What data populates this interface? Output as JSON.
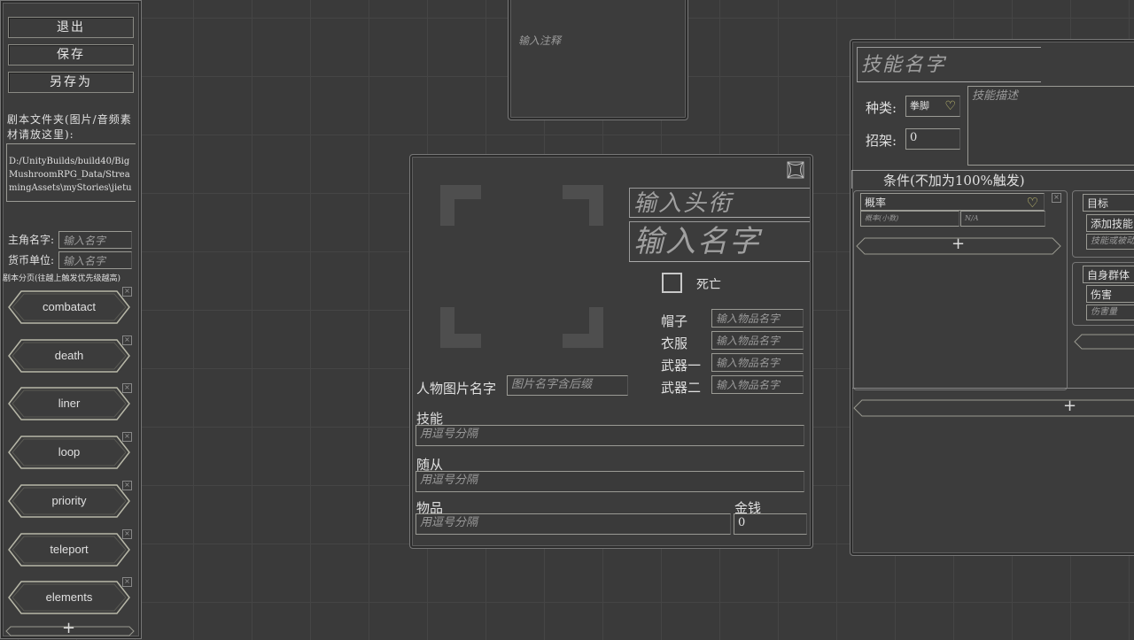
{
  "left": {
    "buttons": {
      "exit": "退出",
      "save": "保存",
      "save_as": "另存为"
    },
    "folder_label": "剧本文件夹(图片/音频素材请放这里):",
    "folder_path": "D:/UnityBuilds/build40/BigMushroomRPG_Data/StreamingAssets\\myStories\\jietu",
    "protagonist_label": "主角名字:",
    "protagonist_placeholder": "输入名字",
    "currency_label": "货币单位:",
    "currency_placeholder": "输入名字",
    "pages_label": "剧本分页(往越上触发优先级越高)",
    "pages": [
      "combatact",
      "death",
      "liner",
      "loop",
      "priority",
      "teleport",
      "elements"
    ],
    "add_glyph": "+"
  },
  "note": {
    "placeholder": "输入注释"
  },
  "character": {
    "title_placeholder": "输入头衔",
    "name_placeholder": "输入名字",
    "dead_label": "死亡",
    "equipment": [
      {
        "label": "帽子",
        "placeholder": "输入物品名字"
      },
      {
        "label": "衣服",
        "placeholder": "输入物品名字"
      },
      {
        "label": "武器一",
        "placeholder": "输入物品名字"
      },
      {
        "label": "武器二",
        "placeholder": "输入物品名字"
      }
    ],
    "image_label": "人物图片名字",
    "image_placeholder": "图片名字含后缀",
    "skills_label": "技能",
    "skills_placeholder": "用逗号分隔",
    "followers_label": "随从",
    "followers_placeholder": "用逗号分隔",
    "items_label": "物品",
    "items_placeholder": "用逗号分隔",
    "money_label": "金钱",
    "money_value": "0"
  },
  "skill": {
    "name_placeholder": "技能名字",
    "type_label": "种类:",
    "type_value": "拳脚",
    "desc_placeholder": "技能描述",
    "parry_label": "招架:",
    "parry_value": "0",
    "condition_label": "条件(不加为100%触发)",
    "prob_select": "概率",
    "prob_placeholder": "概率(小数)",
    "na_value": "N/A",
    "target_label": "目标",
    "add_skill_label": "添加技能",
    "skill_or_effect_placeholder": "技能或被动",
    "self_group_label": "自身群体",
    "damage_label": "伤害",
    "damage_placeholder": "伤害量",
    "add_glyph": "+"
  }
}
